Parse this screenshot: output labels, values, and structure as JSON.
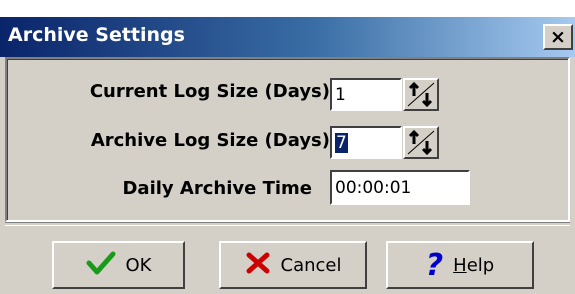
{
  "window": {
    "title": "Archive Settings",
    "close_label": "×"
  },
  "fields": [
    {
      "label": "Current Log Size (Days)",
      "value": "1"
    },
    {
      "label": "Archive Log Size (Days)",
      "value": "7"
    },
    {
      "label": "Daily Archive Time",
      "value": "00:00:01"
    }
  ],
  "buttons": {
    "ok": {
      "label": "OK",
      "icon": "checkmark-icon",
      "color": "#1a9a1a"
    },
    "cancel": {
      "label": "Cancel",
      "icon": "x-mark-icon",
      "color": "#cc0000"
    },
    "help": {
      "label_first": "H",
      "label_rest": "elp",
      "icon": "question-mark-icon",
      "color": "#0000cc"
    }
  }
}
